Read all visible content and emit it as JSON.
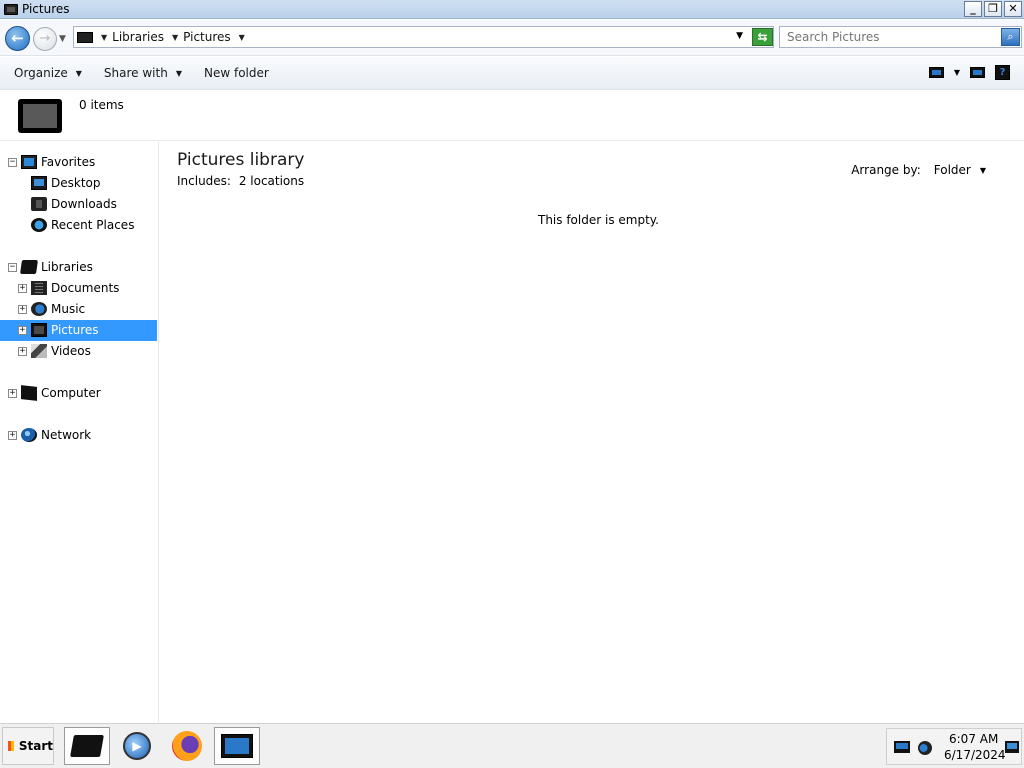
{
  "window": {
    "title": "Pictures",
    "min_glyph": "_",
    "restore_glyph": "❐",
    "close_glyph": "✕"
  },
  "address": {
    "crumbs": [
      "Libraries",
      "Pictures"
    ],
    "search_placeholder": "Search Pictures"
  },
  "toolbar": {
    "organize": "Organize",
    "share_with": "Share with",
    "new_folder": "New folder"
  },
  "details": {
    "items_count": "0 items"
  },
  "nav": {
    "favorites": "Favorites",
    "desktop": "Desktop",
    "downloads": "Downloads",
    "recent_places": "Recent Places",
    "libraries": "Libraries",
    "documents": "Documents",
    "music": "Music",
    "pictures": "Pictures",
    "videos": "Videos",
    "computer": "Computer",
    "network": "Network",
    "selected": "Pictures"
  },
  "content": {
    "title": "Pictures library",
    "includes_label": "Includes:",
    "includes_value": "2 locations",
    "arrange_label": "Arrange by:",
    "arrange_value": "Folder",
    "empty_message": "This folder is empty."
  },
  "taskbar": {
    "start": "Start",
    "time": "6:07 AM",
    "date": "6/17/2024"
  },
  "colors": {
    "selection": "#3399ff",
    "title_bar": "#b9d1ea"
  },
  "icons": {
    "back": "back-arrow-icon",
    "forward": "forward-arrow-icon",
    "search": "search-icon",
    "refresh": "refresh-icon"
  }
}
